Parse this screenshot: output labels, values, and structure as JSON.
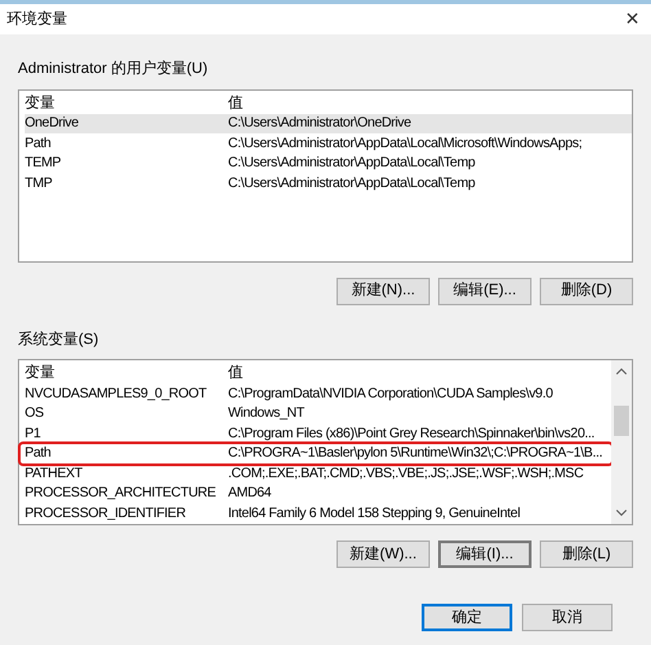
{
  "window": {
    "title": "环境变量",
    "close": "✕"
  },
  "user_vars": {
    "label": "Administrator 的用户变量(U)",
    "columns": [
      "变量",
      "值"
    ],
    "rows": [
      {
        "name": "OneDrive",
        "value": "C:\\Users\\Administrator\\OneDrive",
        "selected": true,
        "highlighted": false
      },
      {
        "name": "Path",
        "value": "C:\\Users\\Administrator\\AppData\\Local\\Microsoft\\WindowsApps;",
        "selected": false,
        "highlighted": false
      },
      {
        "name": "TEMP",
        "value": "C:\\Users\\Administrator\\AppData\\Local\\Temp",
        "selected": false,
        "highlighted": false
      },
      {
        "name": "TMP",
        "value": "C:\\Users\\Administrator\\AppData\\Local\\Temp",
        "selected": false,
        "highlighted": false
      }
    ],
    "buttons": [
      {
        "label": "新建(N)...",
        "focused": false
      },
      {
        "label": "编辑(E)...",
        "focused": false
      },
      {
        "label": "删除(D)",
        "focused": false
      }
    ]
  },
  "system_vars": {
    "label": "系统变量(S)",
    "columns": [
      "变量",
      "值"
    ],
    "rows": [
      {
        "name": "NVCUDASAMPLES9_0_ROOT",
        "value": "C:\\ProgramData\\NVIDIA Corporation\\CUDA Samples\\v9.0",
        "selected": false,
        "highlighted": false
      },
      {
        "name": "OS",
        "value": "Windows_NT",
        "selected": false,
        "highlighted": false
      },
      {
        "name": "P1",
        "value": "C:\\Program Files (x86)\\Point Grey Research\\Spinnaker\\bin\\vs20...",
        "selected": false,
        "highlighted": false
      },
      {
        "name": "Path",
        "value": "C:\\PROGRA~1\\Basler\\pylon 5\\Runtime\\Win32\\;C:\\PROGRA~1\\B...",
        "selected": false,
        "highlighted": true
      },
      {
        "name": "PATHEXT",
        "value": ".COM;.EXE;.BAT;.CMD;.VBS;.VBE;.JS;.JSE;.WSF;.WSH;.MSC",
        "selected": false,
        "highlighted": false
      },
      {
        "name": "PROCESSOR_ARCHITECTURE",
        "value": "AMD64",
        "selected": false,
        "highlighted": false
      },
      {
        "name": "PROCESSOR_IDENTIFIER",
        "value": "Intel64 Family 6 Model 158 Stepping 9, GenuineIntel",
        "selected": false,
        "highlighted": false
      }
    ],
    "buttons": [
      {
        "label": "新建(W)...",
        "focused": false
      },
      {
        "label": "编辑(I)...",
        "focused": true
      },
      {
        "label": "删除(L)",
        "focused": false
      }
    ]
  },
  "footer_buttons": [
    {
      "label": "确定",
      "default": true
    },
    {
      "label": "取消",
      "default": false
    }
  ]
}
